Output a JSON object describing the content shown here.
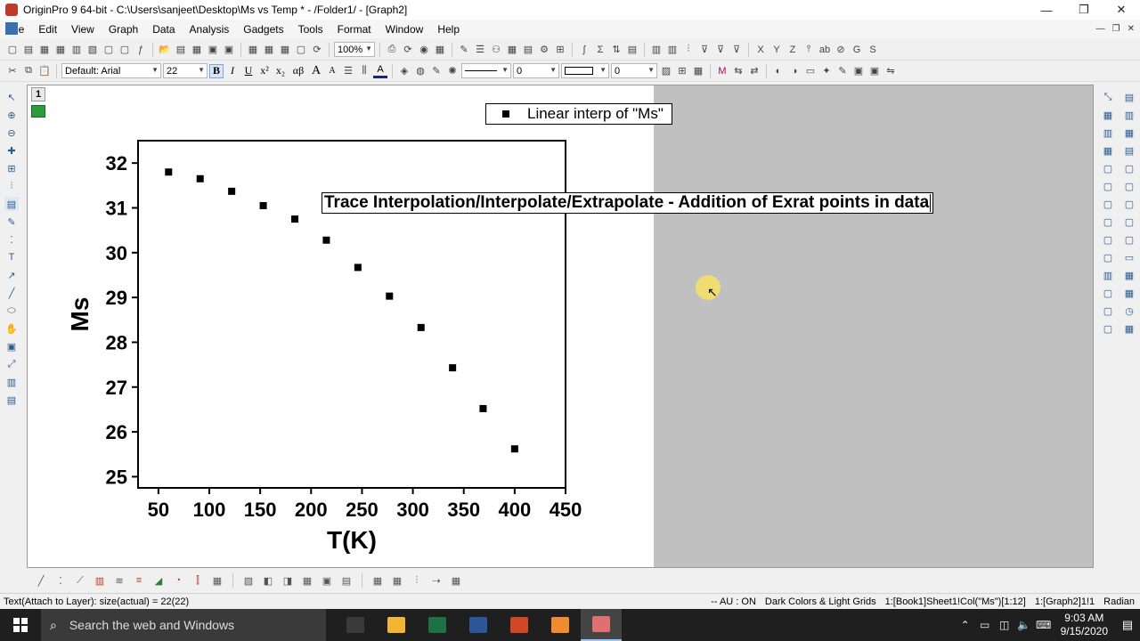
{
  "window": {
    "title": "OriginPro 9 64-bit - C:\\Users\\sanjeet\\Desktop\\Ms vs Temp * - /Folder1/ - [Graph2]",
    "controls": [
      "—",
      "❐",
      "✕"
    ]
  },
  "menu": [
    "File",
    "Edit",
    "View",
    "Graph",
    "Data",
    "Analysis",
    "Gadgets",
    "Tools",
    "Format",
    "Window",
    "Help"
  ],
  "toolbar": {
    "zoom": "100%",
    "font": "Default: Arial",
    "font_size": "22",
    "bold": "B",
    "italic": "I",
    "underline": "U",
    "superscript": "x²",
    "subscript": "x₂",
    "greek": "αβ",
    "increase_font": "A",
    "decrease_font": "A",
    "line_width": "0",
    "border_width": "0"
  },
  "graph": {
    "layer_number": "1",
    "legend_text": "Linear interp of \"Ms\"",
    "text_object": "Trace Interpolation/Interpolate/Extrapolate - Addition of Exrat points in data"
  },
  "chart_data": {
    "type": "scatter",
    "xlabel": "T(K)",
    "ylabel": "Ms",
    "xlim": [
      30,
      450
    ],
    "ylim": [
      24.75,
      32.5
    ],
    "xticks": [
      50,
      100,
      150,
      200,
      250,
      300,
      350,
      400,
      450
    ],
    "yticks": [
      25,
      26,
      27,
      28,
      29,
      30,
      31,
      32
    ],
    "series": [
      {
        "name": "Linear interp of \"Ms\"",
        "x": [
          60,
          91,
          122,
          153,
          184,
          215,
          246,
          277,
          308,
          339,
          369,
          400
        ],
        "y": [
          31.8,
          31.65,
          31.37,
          31.05,
          30.75,
          30.28,
          29.67,
          29.03,
          28.33,
          27.43,
          26.52,
          25.62
        ]
      }
    ],
    "grid": false,
    "legend": "top"
  },
  "status": {
    "left": "Text(Attach to Layer): size(actual) = 22(22)",
    "right": [
      "-- AU : ON",
      "Dark Colors & Light Grids",
      "1:[Book1]Sheet1!Col(\"Ms\")[1:12]",
      "1:[Graph2]1!1",
      "Radian"
    ]
  },
  "taskbar": {
    "search_placeholder": "Search the web and Windows",
    "time": "9:03 AM",
    "date": "9/15/2020",
    "apps": [
      {
        "name": "task-view",
        "color": "#3a3a3a"
      },
      {
        "name": "file-explorer",
        "color": "#f2b632"
      },
      {
        "name": "excel",
        "color": "#1e7145"
      },
      {
        "name": "word",
        "color": "#2b579a"
      },
      {
        "name": "powerpoint",
        "color": "#d24726"
      },
      {
        "name": "recorder",
        "color": "#f28a30"
      },
      {
        "name": "originpro",
        "color": "#e07070"
      }
    ],
    "colors": {
      "active_underline": "#9bc3f0"
    }
  }
}
